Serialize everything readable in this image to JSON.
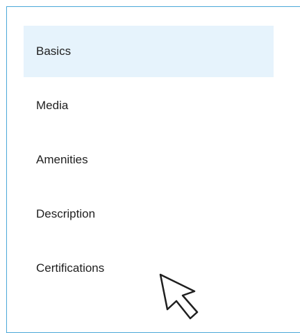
{
  "nav": {
    "items": [
      {
        "label": "Basics",
        "active": true
      },
      {
        "label": "Media",
        "active": false
      },
      {
        "label": "Amenities",
        "active": false
      },
      {
        "label": "Description",
        "active": false
      },
      {
        "label": "Certifications",
        "active": false
      }
    ]
  },
  "colors": {
    "border": "#4aa8d8",
    "active_bg": "#e6f3fc",
    "text": "#1f1f1f"
  },
  "cursor": {
    "icon": "mouse-pointer-icon"
  }
}
